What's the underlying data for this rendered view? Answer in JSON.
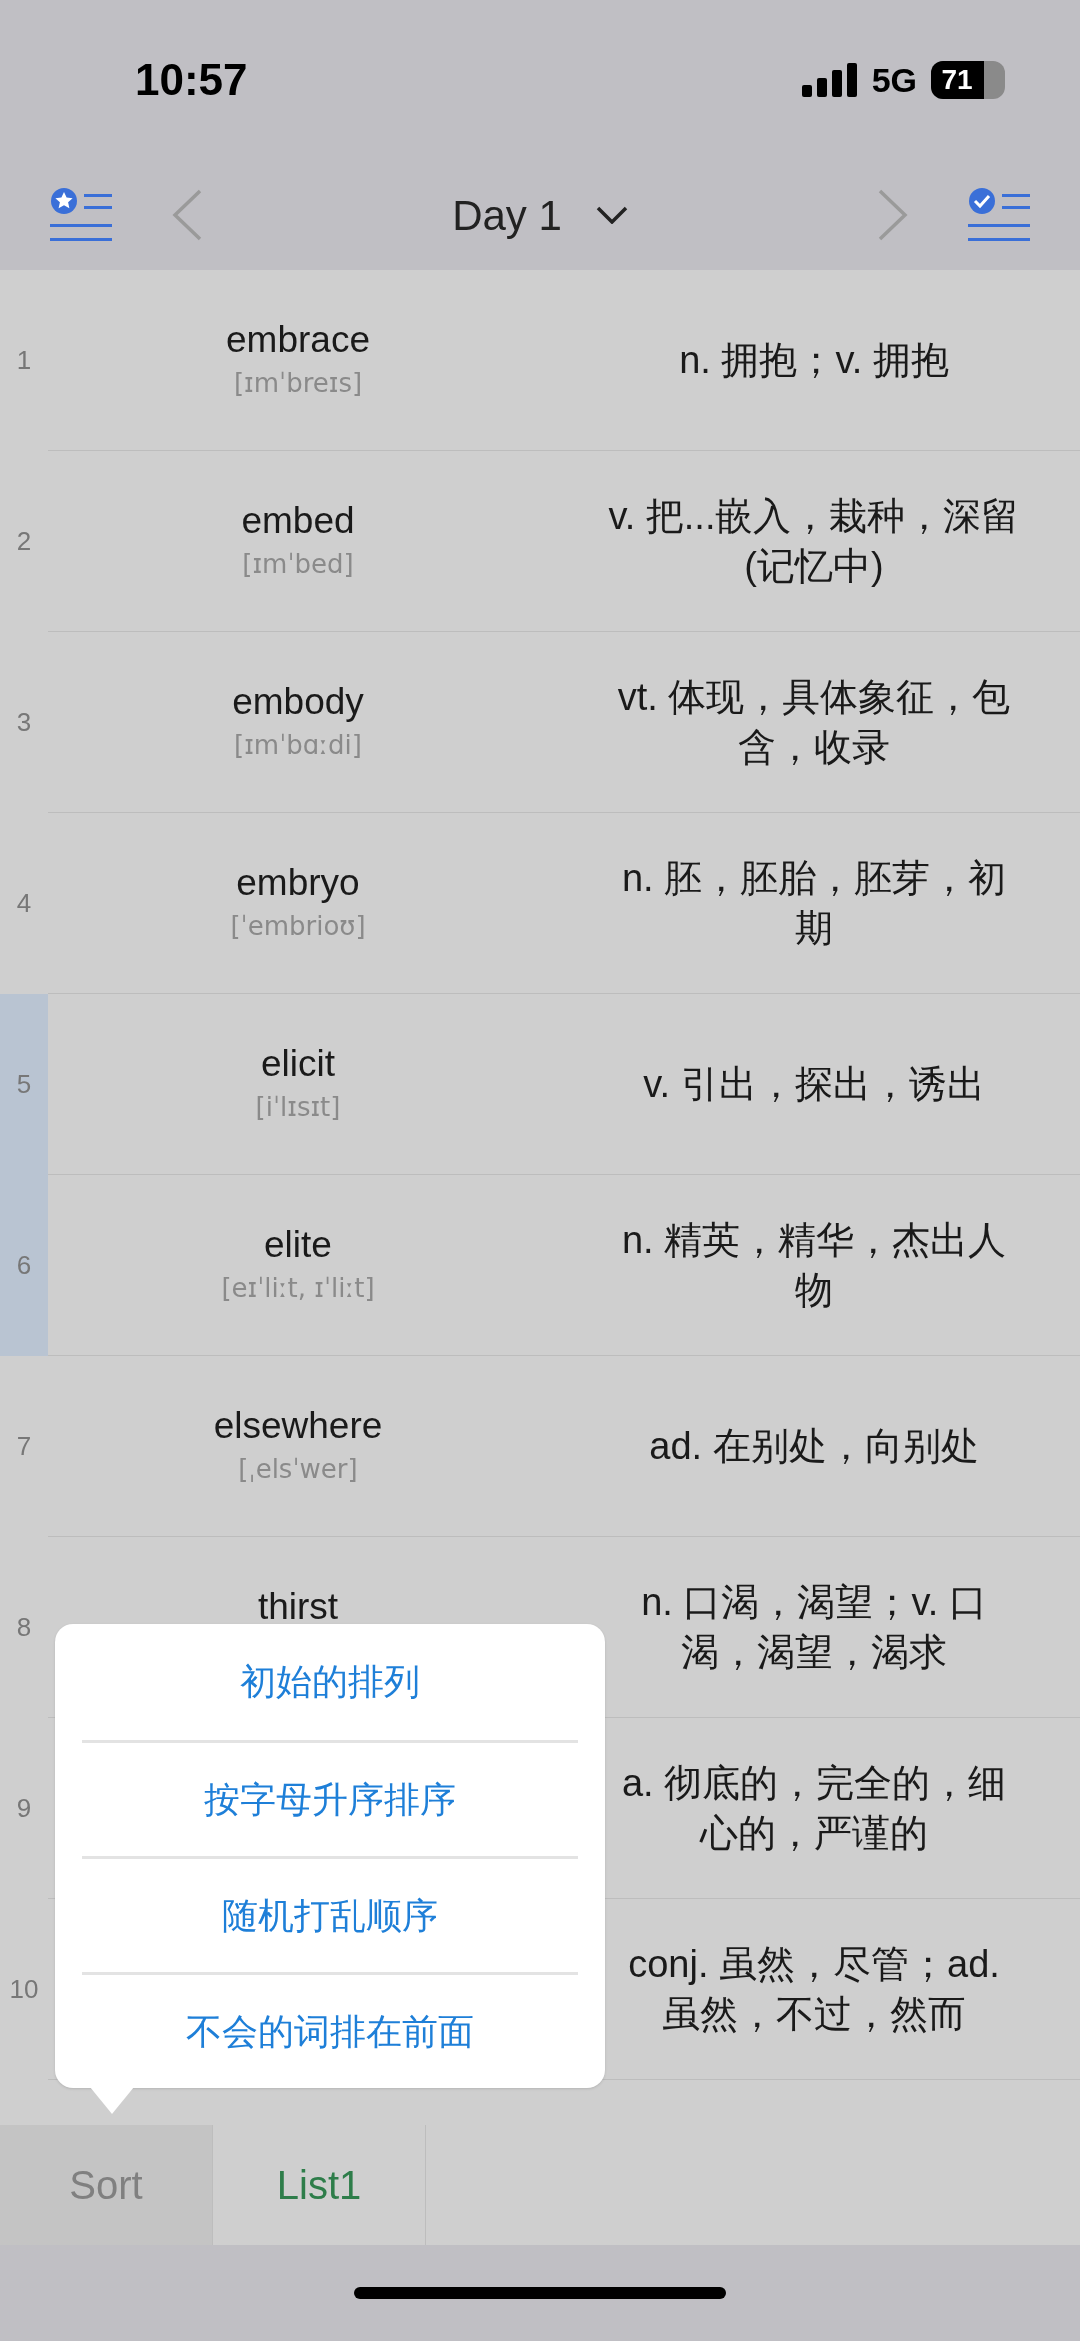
{
  "status_bar": {
    "time": "10:57",
    "network": "5G",
    "battery": "71"
  },
  "nav": {
    "title": "Day 1"
  },
  "rows": [
    {
      "index": "1",
      "word": "embrace",
      "phonetic": "[ɪmˈbreɪs]",
      "meaning": "n. 拥抱；v. 拥抱",
      "marked": false
    },
    {
      "index": "2",
      "word": "embed",
      "phonetic": "[ɪmˈbed]",
      "meaning": "v. 把...嵌入，栽种，深留 (记忆中)",
      "marked": false
    },
    {
      "index": "3",
      "word": "embody",
      "phonetic": "[ɪmˈbɑːdi]",
      "meaning": "vt. 体现，具体象征，包含，收录",
      "marked": false
    },
    {
      "index": "4",
      "word": "embryo",
      "phonetic": "[ˈembrioʊ]",
      "meaning": "n. 胚，胚胎，胚芽，初期",
      "marked": false
    },
    {
      "index": "5",
      "word": "elicit",
      "phonetic": "[iˈlɪsɪt]",
      "meaning": "v. 引出，探出，诱出",
      "marked": true
    },
    {
      "index": "6",
      "word": "elite",
      "phonetic": "[eɪˈliːt, ɪˈliːt]",
      "meaning": "n. 精英，精华，杰出人物",
      "marked": true
    },
    {
      "index": "7",
      "word": "elsewhere",
      "phonetic": "[ˌelsˈwer]",
      "meaning": "ad. 在别处，向别处",
      "marked": false
    },
    {
      "index": "8",
      "word": "thirst",
      "meaning": "n. 口渴，渴望；v. 口渴，渴望，渴求",
      "marked": false
    },
    {
      "index": "9",
      "meaning": "a. 彻底的，完全的，细心的，严谨的",
      "marked": false
    },
    {
      "index": "10",
      "meaning": "conj. 虽然，尽管；ad. 虽然，不过，然而",
      "marked": false
    }
  ],
  "sort_menu": [
    "初始的排列",
    "按字母升序排序",
    "随机打乱顺序",
    "不会的词排在前面"
  ],
  "tabs": [
    {
      "label": "Sort",
      "selected": true
    },
    {
      "label": "List1",
      "selected": false
    }
  ]
}
